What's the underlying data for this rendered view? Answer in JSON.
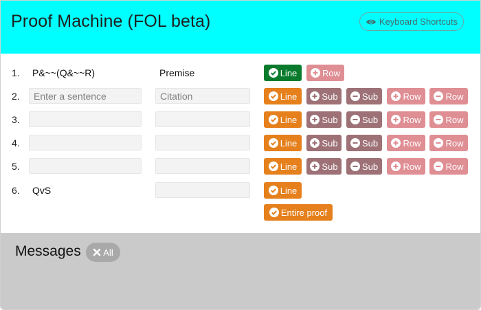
{
  "header": {
    "title": "Proof Machine (FOL beta)",
    "keyboard_button": "Keyboard Shortcuts",
    "keyboard_icon": "eye-icon",
    "bg_color": "#00ffff"
  },
  "proof": {
    "rows": [
      {
        "num": "1.",
        "sentence": "P&~~(Q&~~R)",
        "citation": "Premise"
      },
      {
        "num": "2.",
        "sentence_placeholder": "Enter a sentence",
        "citation_placeholder": "Citation"
      },
      {
        "num": "3."
      },
      {
        "num": "4."
      },
      {
        "num": "5."
      },
      {
        "num": "6.",
        "sentence": "QvS"
      }
    ],
    "buttons": {
      "line": "Line",
      "sub": "Sub",
      "row": "Row",
      "entire": "Entire proof"
    },
    "colors": {
      "line_checked": "#0a7b2c",
      "line": "#e5801c",
      "sub": "#9d7176",
      "row": "#df8e94"
    }
  },
  "messages": {
    "title": "Messages",
    "clear_label": "All",
    "bg_color": "#cacaca"
  }
}
